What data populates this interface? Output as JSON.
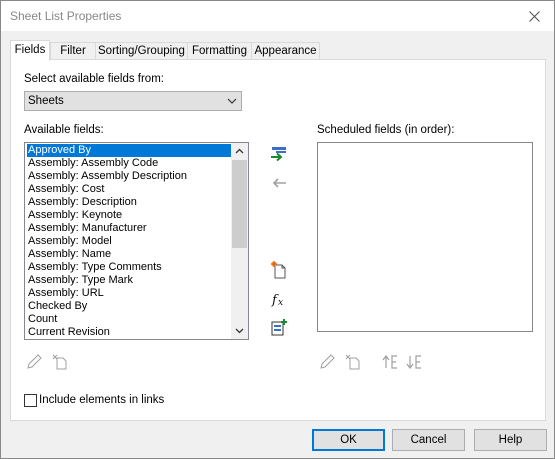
{
  "window": {
    "title": "Sheet List Properties"
  },
  "tabs": [
    {
      "label": "Fields",
      "active": true
    },
    {
      "label": "Filter"
    },
    {
      "label": "Sorting/Grouping"
    },
    {
      "label": "Formatting"
    },
    {
      "label": "Appearance"
    }
  ],
  "fields_tab": {
    "select_from_label": "Select available fields from:",
    "select_from_value": "Sheets",
    "available_label": "Available fields:",
    "available_fields": [
      "Approved By",
      "Assembly: Assembly Code",
      "Assembly: Assembly Description",
      "Assembly: Cost",
      "Assembly: Description",
      "Assembly: Keynote",
      "Assembly: Manufacturer",
      "Assembly: Model",
      "Assembly: Name",
      "Assembly: Type Comments",
      "Assembly: Type Mark",
      "Assembly: URL",
      "Checked By",
      "Count",
      "Current Revision"
    ],
    "selected_field": "Approved By",
    "scheduled_label": "Scheduled fields (in order):",
    "scheduled_fields": [],
    "include_links_label": "Include elements in links",
    "include_links_checked": false
  },
  "buttons": {
    "ok": "OK",
    "cancel": "Cancel",
    "help": "Help"
  },
  "colors": {
    "selection": "#0078d7",
    "add_arrow": "#1a8a2e",
    "disabled_icon": "#a0a0a0"
  },
  "icons": [
    "close-icon",
    "chevron-down-icon",
    "add-parameter-arrow-icon",
    "remove-parameter-arrow-icon",
    "new-parameter-icon",
    "calculated-value-icon",
    "combine-parameters-icon",
    "edit-parameter-icon",
    "delete-parameter-icon",
    "move-up-icon",
    "move-down-icon"
  ]
}
